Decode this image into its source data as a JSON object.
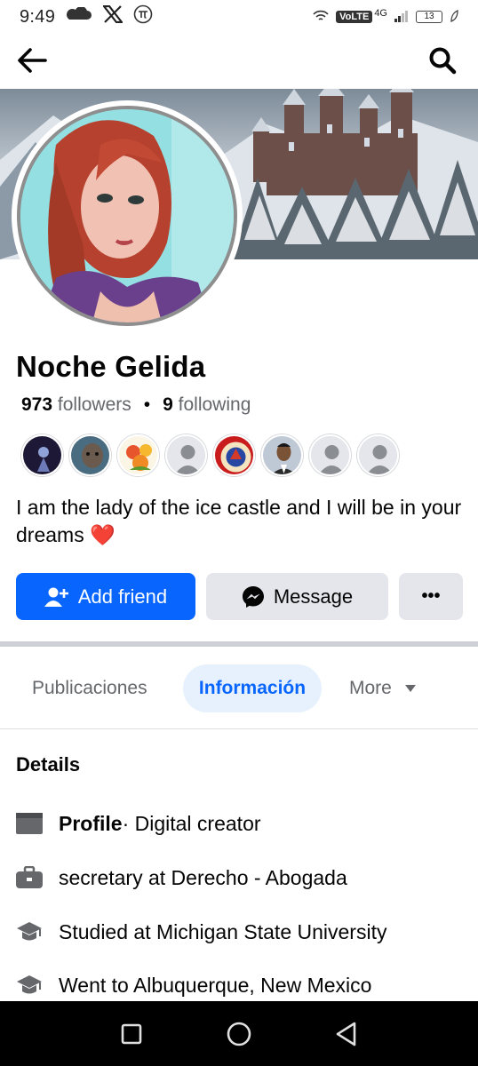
{
  "status_bar": {
    "time": "9:49",
    "network_label": "VoLTE",
    "network_type": "4G",
    "battery": "13"
  },
  "profile": {
    "name": "Noche Gelida",
    "followers_count": "973",
    "followers_label": "followers",
    "following_count": "9",
    "following_label": "following",
    "bio": "I am the lady of the ice castle and I will be in your dreams",
    "bio_emoji": "❤️"
  },
  "actions": {
    "add_friend_label": "Add friend",
    "message_label": "Message",
    "more_label": "•••"
  },
  "tabs": [
    {
      "label": "Publicaciones",
      "active": false
    },
    {
      "label": "Información",
      "active": true
    },
    {
      "label": "More",
      "active": false
    }
  ],
  "details": {
    "title": "Details",
    "items": [
      {
        "icon": "profile-card-icon",
        "bold": "Profile",
        "text": " · Digital creator"
      },
      {
        "icon": "briefcase-icon",
        "bold": "",
        "text": "secretary at Derecho - Abogada"
      },
      {
        "icon": "graduation-cap-icon",
        "bold": "",
        "text": "Studied at Michigan State University"
      },
      {
        "icon": "graduation-cap-icon",
        "bold": "",
        "text": "Went to Albuquerque, New Mexico"
      }
    ]
  },
  "colors": {
    "accent": "#0866ff",
    "button_gray": "#e4e6eb",
    "secondary_text": "#65676b",
    "nav_bar": "#000000"
  }
}
